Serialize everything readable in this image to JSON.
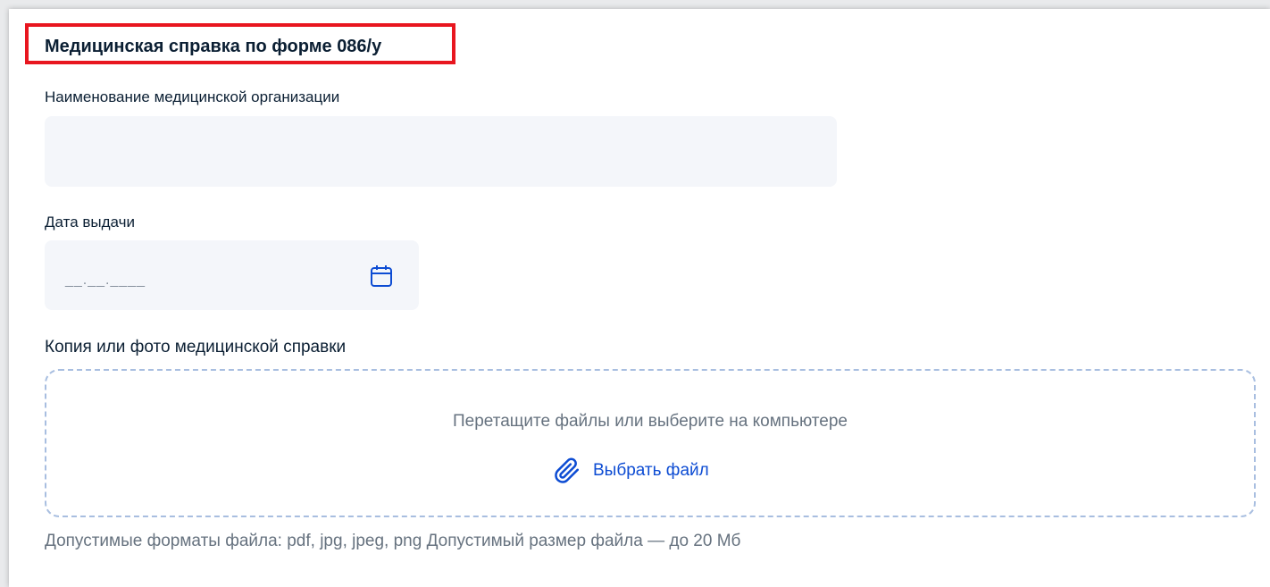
{
  "form": {
    "title": "Медицинская справка по форме 086/у",
    "org_name": {
      "label": "Наименование медицинской организации",
      "value": ""
    },
    "issue_date": {
      "label": "Дата выдачи",
      "placeholder": "__.__.____",
      "icon": "calendar-icon"
    },
    "upload": {
      "label": "Копия или фото медицинской справки",
      "drop_text": "Перетащите файлы или выберите на компьютере",
      "choose_label": "Выбрать файл",
      "icon": "paperclip-icon",
      "hint": "Допустимые форматы файла: pdf, jpg, jpeg, png Допустимый размер файла — до 20 Мб"
    }
  },
  "colors": {
    "highlight_border": "#e8161f",
    "field_background": "#f4f6fa",
    "link": "#0d4cd3",
    "dropzone_border": "#a8bee0",
    "text_primary": "#0b1f33",
    "text_secondary": "#66727f"
  }
}
